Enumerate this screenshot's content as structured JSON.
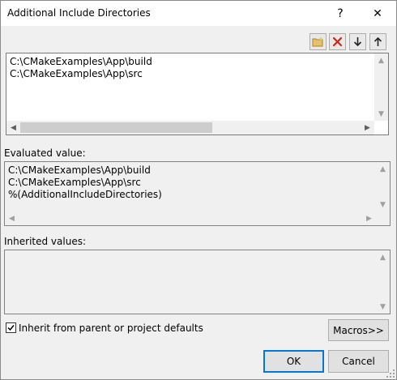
{
  "window": {
    "title": "Additional Include Directories",
    "help_symbol": "?",
    "close_symbol": "✕"
  },
  "toolbar": {
    "icons": [
      "new-folder-icon",
      "delete-icon",
      "move-down-icon",
      "move-up-icon"
    ],
    "delete_color": "#c42b1c"
  },
  "directories": {
    "lines": [
      "C:\\CMakeExamples\\App\\build",
      "C:\\CMakeExamples\\App\\src"
    ]
  },
  "evaluated": {
    "label": "Evaluated value:",
    "lines": [
      "C:\\CMakeExamples\\App\\build",
      "C:\\CMakeExamples\\App\\src",
      "%(AdditionalIncludeDirectories)"
    ]
  },
  "inherited": {
    "label": "Inherited values:"
  },
  "inherit_checkbox": {
    "label": "Inherit from parent or project defaults",
    "checked": true
  },
  "buttons": {
    "macros": "Macros>>",
    "ok": "OK",
    "cancel": "Cancel"
  },
  "colors": {
    "accent": "#0078d7"
  }
}
